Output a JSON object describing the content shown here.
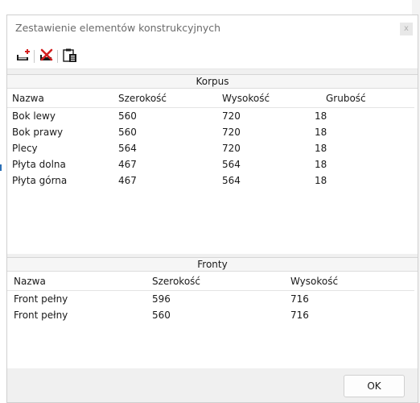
{
  "window": {
    "title": "Zestawienie elementów konstrukcyjnych",
    "close_glyph": "x"
  },
  "toolbar": {
    "icons": [
      "add-element-icon",
      "delete-element-icon",
      "copy-clipboard-icon"
    ]
  },
  "korpus": {
    "caption": "Korpus",
    "columns": [
      "Nazwa",
      "Szerokość",
      "Wysokość",
      "Grubość"
    ],
    "rows": [
      [
        "Bok lewy",
        "560",
        "720",
        "18"
      ],
      [
        "Bok prawy",
        "560",
        "720",
        "18"
      ],
      [
        "Plecy",
        "564",
        "720",
        "18"
      ],
      [
        "Płyta dolna",
        "467",
        "564",
        "18"
      ],
      [
        "Płyta górna",
        "467",
        "564",
        "18"
      ]
    ]
  },
  "fronty": {
    "caption": "Fronty",
    "columns": [
      "Nazwa",
      "Szerokość",
      "Wysokość"
    ],
    "rows": [
      [
        "Front pełny",
        "596",
        "716"
      ],
      [
        "Front pełny",
        "560",
        "716"
      ]
    ]
  },
  "footer": {
    "ok_label": "OK"
  }
}
